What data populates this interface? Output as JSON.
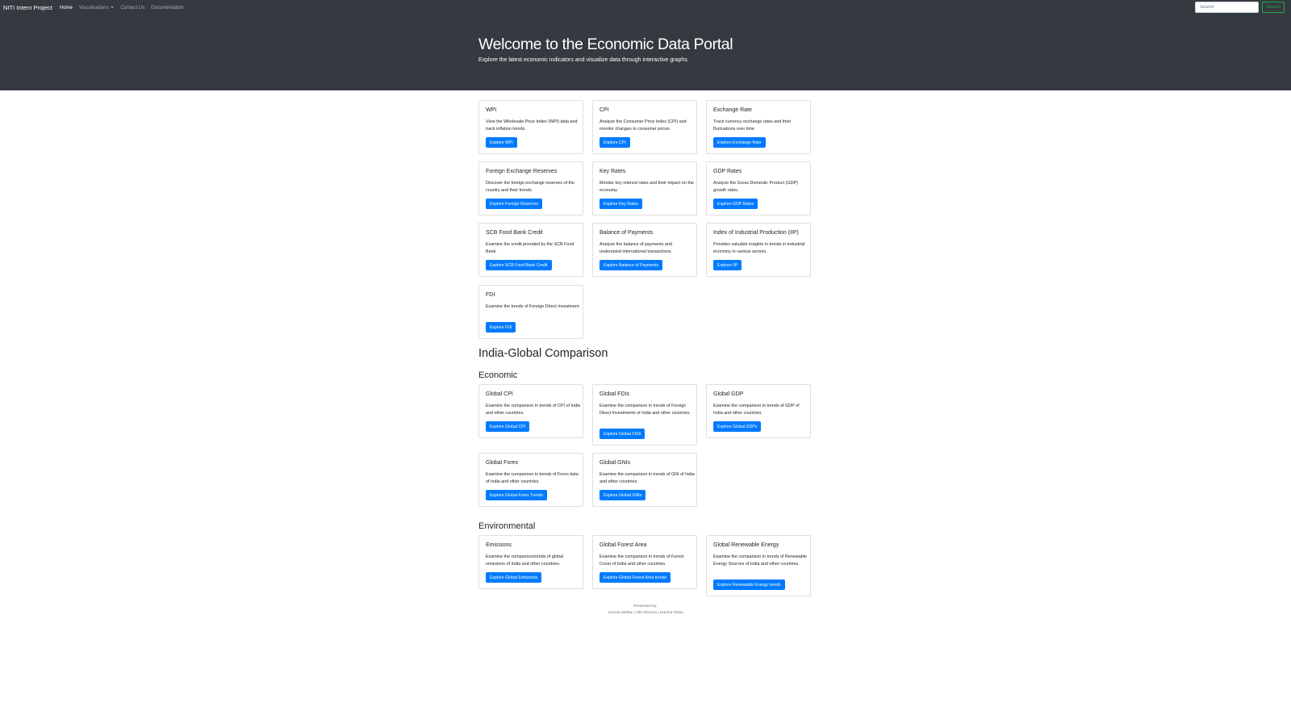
{
  "navbar": {
    "brand": "NITI Intern Project",
    "links": [
      "Home",
      "Visualisations",
      "Contact Us",
      "Documentation"
    ],
    "search_placeholder": "Search",
    "search_button": "Search"
  },
  "hero": {
    "title": "Welcome to the Economic Data Portal",
    "subtitle": "Explore the latest economic indicators and visualize data through interactive graphs."
  },
  "indicators": [
    {
      "title": "WPI",
      "text": "View the Wholesale Price Index (WPI) data and track inflation trends.",
      "button": "Explore WPI"
    },
    {
      "title": "CPI",
      "text": "Analyze the Consumer Price Index (CPI) and monitor changes in consumer prices.",
      "button": "Explore CPI"
    },
    {
      "title": "Exchange Rate",
      "text": "Track currency exchange rates and their fluctuations over time.",
      "button": "Explore Exchange Rate"
    },
    {
      "title": "Foreign Exchange Reserves",
      "text": "Discover the foreign exchange reserves of the country and their trends.",
      "button": "Explore Foreign Reserves"
    },
    {
      "title": "Key Rates",
      "text": "Monitor key interest rates and their impact on the economy.",
      "button": "Explore Key Rates"
    },
    {
      "title": "GDP Rates",
      "text": "Analyze the Gross Domestic Product (GDP) growth rates.",
      "button": "Explore GDP Rates"
    },
    {
      "title": "SCB Food Bank Credit",
      "text": "Examine the credit provided by the SCB Food Bank.",
      "button": "Explore SCB Food Bank Credit"
    },
    {
      "title": "Balance of Payments",
      "text": "Analyze the balance of payments and understand international transactions.",
      "button": "Explore Balance of Payments"
    },
    {
      "title": "Index of Industrial Production (IIP)",
      "text": "Provides valuable insights in trends in industrial economy in various sectors.",
      "button": "Explore IIP"
    },
    {
      "title": "FDI",
      "text": "Examine the trends of Foreign Direct Investment.",
      "button": "Explore FDI"
    }
  ],
  "comparison": {
    "title": "India-Global Comparison",
    "economic": {
      "title": "Economic",
      "cards": [
        {
          "title": "Global CPI",
          "text": "Examine the comparison in trends of CPI of India and other countries.",
          "button": "Explore Global CPI"
        },
        {
          "title": "Global FDIs",
          "text": "Examine the comparison in trends of Foreign Direct Investments of India and other countries.",
          "button": "Explore Global FDIs"
        },
        {
          "title": "Global GDP",
          "text": "Examine the comparison in trends of GDP of India and other countries.",
          "button": "Explore Global GDPs"
        },
        {
          "title": "Global Forex",
          "text": "Examine the comparison in trends of Forex data of India and other countries.",
          "button": "Explore Global Forex Trends"
        },
        {
          "title": "Global GNIs",
          "text": "Examine the comparison in trends of GNI of India and other countries.",
          "button": "Explore Global GNIs"
        }
      ]
    },
    "environmental": {
      "title": "Environmental",
      "cards": [
        {
          "title": "Emissions",
          "text": "Examine the comparisontrends of global emissions of India and other countries.",
          "button": "Explore Global Emissions"
        },
        {
          "title": "Global Forest Area",
          "text": "Examine the comparison in trends of Forest Cover of India and other countries.",
          "button": "Explore Global Forest Area trends"
        },
        {
          "title": "Global Renewable Energy",
          "text": "Examine the comparison in trends of Renewable Energy Sources of India and other countries.",
          "button": "Explore Renewable Energy trends"
        }
      ]
    }
  },
  "footer": {
    "line1": "Presented by:",
    "line2": "Suneet Mehta | Udit Sharma | Harshit Shaw"
  },
  "colors": {
    "navbar_bg": "#343a40",
    "primary": "#007bff",
    "search_outline": "#28a745"
  }
}
